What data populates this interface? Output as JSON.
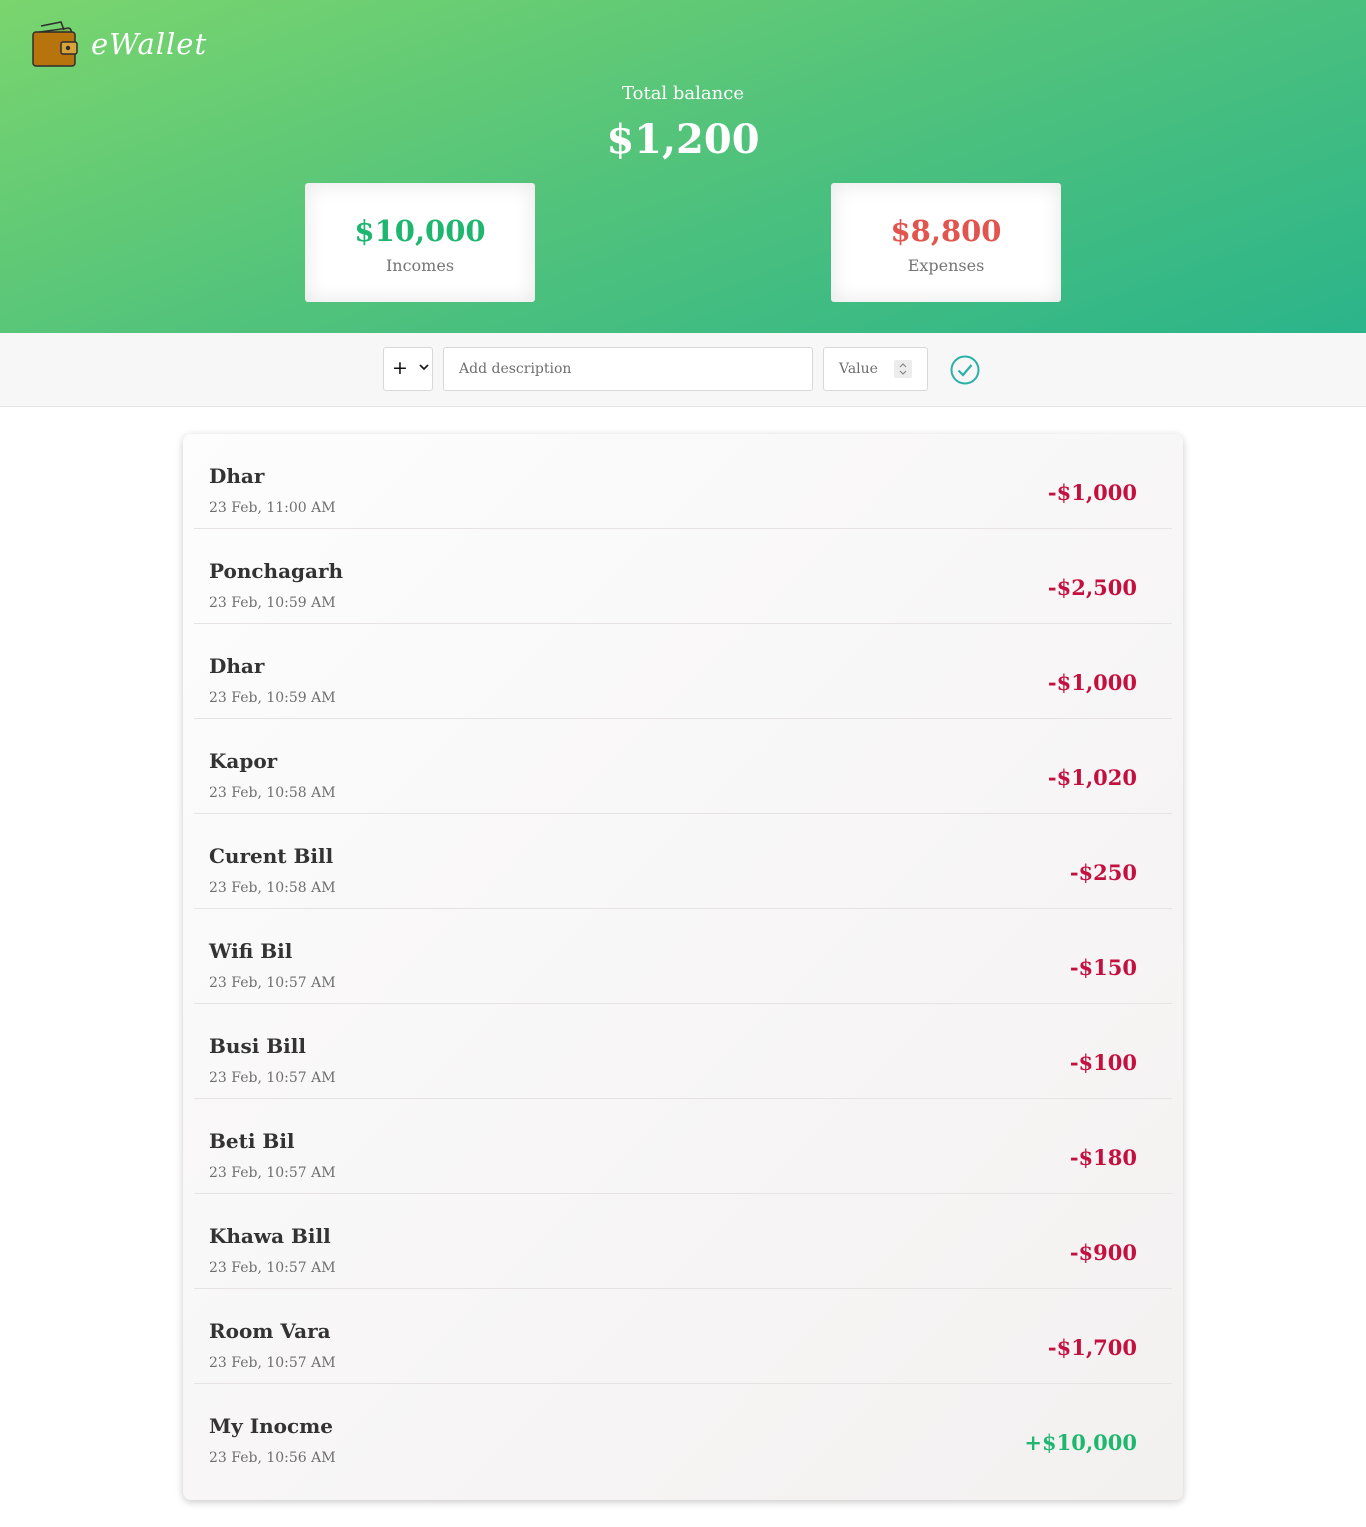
{
  "app": {
    "name": "eWallet"
  },
  "summary": {
    "balance_label": "Total balance",
    "balance_value": "$1,200",
    "income_value": "$10,000",
    "income_label": "Incomes",
    "expense_value": "$8,800",
    "expense_label": "Expenses"
  },
  "form": {
    "type_value": "+",
    "description_placeholder": "Add description",
    "value_placeholder": "Value"
  },
  "transactions": [
    {
      "description": "Dhar",
      "time": "23 Feb, 11:00 AM",
      "amount": "-$1,000",
      "type": "expense"
    },
    {
      "description": "Ponchagarh",
      "time": "23 Feb, 10:59 AM",
      "amount": "-$2,500",
      "type": "expense"
    },
    {
      "description": "Dhar",
      "time": "23 Feb, 10:59 AM",
      "amount": "-$1,000",
      "type": "expense"
    },
    {
      "description": "Kapor",
      "time": "23 Feb, 10:58 AM",
      "amount": "-$1,020",
      "type": "expense"
    },
    {
      "description": "Curent Bill",
      "time": "23 Feb, 10:58 AM",
      "amount": "-$250",
      "type": "expense"
    },
    {
      "description": "Wifi Bil",
      "time": "23 Feb, 10:57 AM",
      "amount": "-$150",
      "type": "expense"
    },
    {
      "description": "Busi Bill",
      "time": "23 Feb, 10:57 AM",
      "amount": "-$100",
      "type": "expense"
    },
    {
      "description": "Beti Bil",
      "time": "23 Feb, 10:57 AM",
      "amount": "-$180",
      "type": "expense"
    },
    {
      "description": "Khawa Bill",
      "time": "23 Feb, 10:57 AM",
      "amount": "-$900",
      "type": "expense"
    },
    {
      "description": "Room Vara",
      "time": "23 Feb, 10:57 AM",
      "amount": "-$1,700",
      "type": "expense"
    },
    {
      "description": "My Inocme",
      "time": "23 Feb, 10:56 AM",
      "amount": "+$10,000",
      "type": "income"
    }
  ],
  "colors": {
    "income": "#1fb770",
    "expense_card": "#e2554f",
    "expense_item": "#c3103f",
    "check": "#2bb0a8"
  },
  "icons": {
    "logo": "wallet-icon",
    "type_caret": "chevron-down-icon",
    "spinner": "number-spinner-icon",
    "submit": "check-circle-icon"
  }
}
